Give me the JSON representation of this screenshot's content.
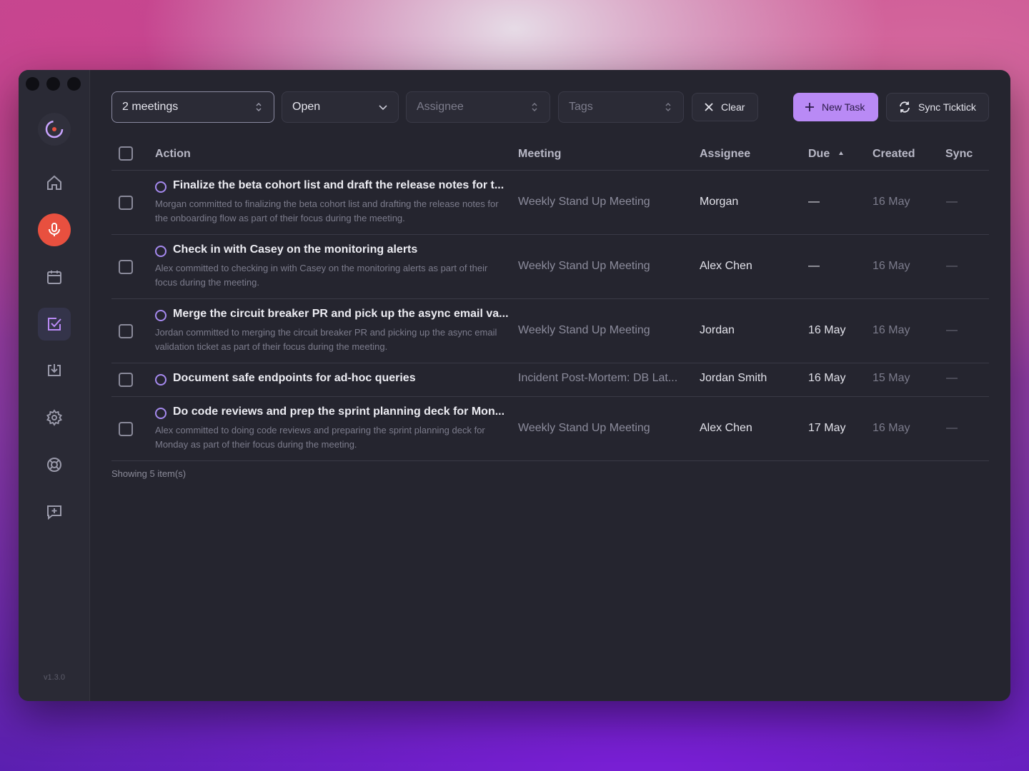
{
  "filters": {
    "meetings": "2 meetings",
    "status": "Open",
    "assignee_placeholder": "Assignee",
    "tags_placeholder": "Tags",
    "clear": "Clear"
  },
  "toolbar": {
    "new_task": "New Task",
    "sync": "Sync Ticktick"
  },
  "columns": {
    "action": "Action",
    "meeting": "Meeting",
    "assignee": "Assignee",
    "due": "Due",
    "created": "Created",
    "sync": "Sync"
  },
  "rows": [
    {
      "title": "Finalize the beta cohort list and draft the release notes for t...",
      "desc": "Morgan committed to finalizing the beta cohort list and drafting the release notes for the onboarding flow as part of their focus during the meeting.",
      "meeting": "Weekly Stand Up Meeting",
      "assignee": "Morgan",
      "due": "—",
      "created": "16 May",
      "sync": "—"
    },
    {
      "title": "Check in with Casey on the monitoring alerts",
      "desc": "Alex committed to checking in with Casey on the monitoring alerts as part of their focus during the meeting.",
      "meeting": "Weekly Stand Up Meeting",
      "assignee": "Alex Chen",
      "due": "—",
      "created": "16 May",
      "sync": "—"
    },
    {
      "title": "Merge the circuit breaker PR and pick up the async email va...",
      "desc": "Jordan committed to merging the circuit breaker PR and picking up the async email validation ticket as part of their focus during the meeting.",
      "meeting": "Weekly Stand Up Meeting",
      "assignee": "Jordan",
      "due": "16 May",
      "created": "16 May",
      "sync": "—"
    },
    {
      "title": "Document safe endpoints for ad-hoc queries",
      "desc": "",
      "meeting": "Incident Post-Mortem: DB Lat...",
      "assignee": "Jordan Smith",
      "due": "16 May",
      "created": "15 May",
      "sync": "—"
    },
    {
      "title": "Do code reviews and prep the sprint planning deck for Mon...",
      "desc": "Alex committed to doing code reviews and preparing the sprint planning deck for Monday as part of their focus during the meeting.",
      "meeting": "Weekly Stand Up Meeting",
      "assignee": "Alex Chen",
      "due": "17 May",
      "created": "16 May",
      "sync": "—"
    }
  ],
  "footer": "Showing 5 item(s)",
  "version": "v1.3.0",
  "sidebar_icons": [
    "app-logo-icon",
    "home-icon",
    "microphone-icon",
    "calendar-icon",
    "tasks-icon",
    "download-icon",
    "gear-icon",
    "help-buoy-icon",
    "feedback-icon"
  ],
  "colors": {
    "accent": "#b98af5",
    "record": "#e8503f",
    "window_bg": "#25252f"
  }
}
